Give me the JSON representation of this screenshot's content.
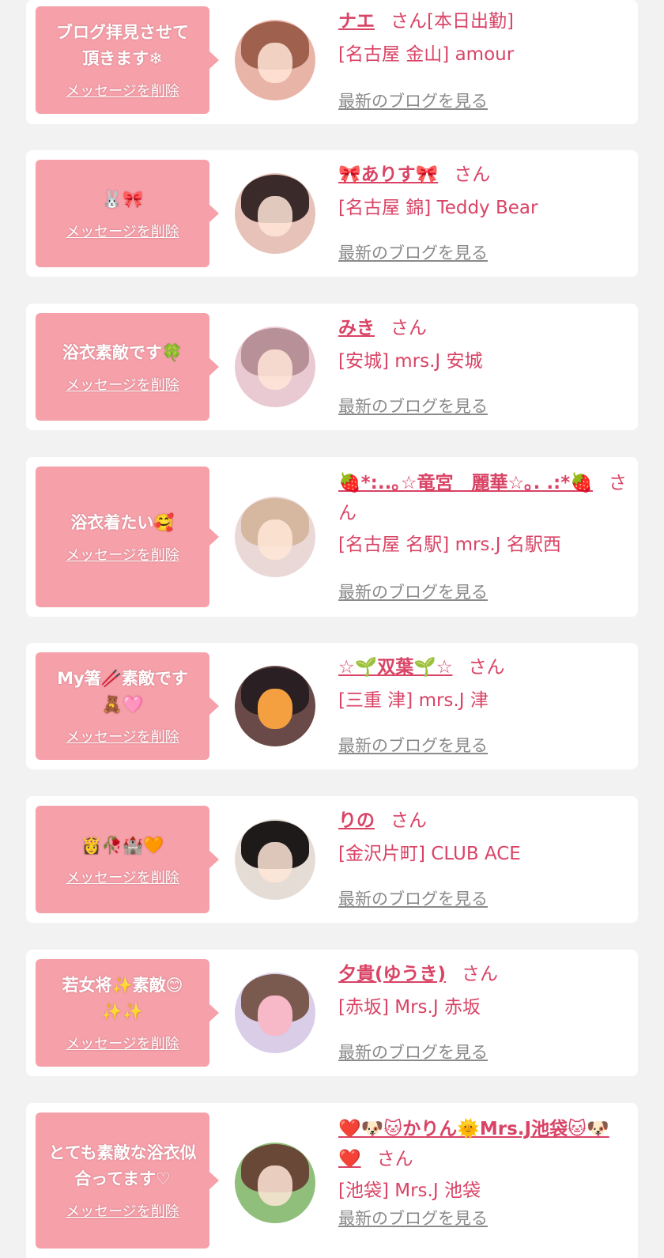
{
  "cards": [
    {
      "message": "ブログ拝見させて頂きます❄",
      "delete_label": "メッセージを削除",
      "name": "ナエ",
      "san": "さん[本日出勤]",
      "shop": "[名古屋 金山] amour",
      "blog_link": "最新のブログを見る",
      "avatar_colors": [
        "#e8b4a8",
        "#9b5a4a"
      ]
    },
    {
      "message": "🐰🎀",
      "delete_label": "メッセージを削除",
      "name": "🎀ありす🎀",
      "san": "さん",
      "shop": "[名古屋 錦] Teddy Bear",
      "blog_link": "最新のブログを見る",
      "avatar_colors": [
        "#e7c2b8",
        "#3a2a2a"
      ]
    },
    {
      "message": "浴衣素敵です🍀",
      "delete_label": "メッセージを削除",
      "name": "みき",
      "san": "さん",
      "shop": "[安城] mrs.J 安城",
      "blog_link": "最新のブログを見る",
      "avatar_colors": [
        "#e9c9d2",
        "#8a6a70"
      ]
    },
    {
      "message": "浴衣着たい🥰",
      "delete_label": "メッセージを削除",
      "name": "🍓*:..｡☆竜宮　麗華☆｡. .:*🍓",
      "san": "さん",
      "shop": "[名古屋 名駅] mrs.J 名駅西",
      "blog_link": "最新のブログを見る",
      "avatar_colors": [
        "#ead8d6",
        "#d6b8a0"
      ]
    },
    {
      "message": "My箸🥢素敵です🧸🩷",
      "delete_label": "メッセージを削除",
      "name": "☆🌱双葉🌱☆",
      "san": "さん",
      "shop": "[三重 津] mrs.J 津",
      "blog_link": "最新のブログを見る",
      "avatar_colors": [
        "#6a4a48",
        "#2a1f22"
      ]
    },
    {
      "message": "👸🥀🏰🧡",
      "delete_label": "メッセージを削除",
      "name": "りの",
      "san": "さん",
      "shop": "[金沢片町] CLUB ACE",
      "blog_link": "最新のブログを見る",
      "avatar_colors": [
        "#e5ddd5",
        "#1e1a1a"
      ]
    },
    {
      "message": "若女将✨素敵😊✨✨",
      "delete_label": "メッセージを削除",
      "name": "夕貴(ゆうき)",
      "san": "さん",
      "shop": "[赤坂] Mrs.J 赤坂",
      "blog_link": "最新のブログを見る",
      "avatar_colors": [
        "#d9cde8",
        "#7a5a4e"
      ]
    },
    {
      "message": "とても素敵な浴衣似合ってます♡",
      "delete_label": "メッセージを削除",
      "name": "❤️🐶🐱かりん🌞Mrs.J池袋🐱🐶❤️",
      "san": "さん",
      "shop": "[池袋] Mrs.J 池袋",
      "blog_link": "最新のブログを見る",
      "avatar_colors": [
        "#8fbf7a",
        "#6a4838"
      ]
    }
  ]
}
